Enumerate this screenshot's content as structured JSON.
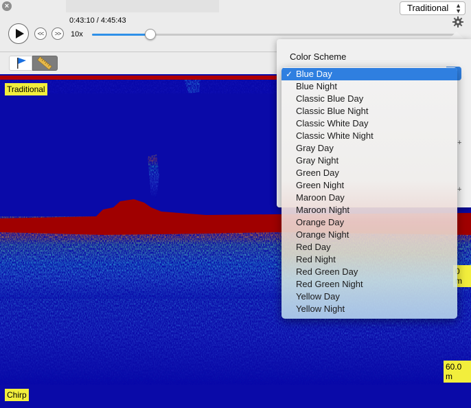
{
  "player": {
    "close_icon": "close-icon",
    "time_readout": "0:43:10 / 4:45:43",
    "speed": "10x",
    "progress_fraction": 0.16,
    "back_label": "<<",
    "forward_label": ">>"
  },
  "view_select": {
    "value": "Traditional"
  },
  "tools": {
    "flag_icon": "flag-icon",
    "ruler_icon": "ruler-icon"
  },
  "sonar": {
    "label_top": "Traditional",
    "label_bottom": "Chirp",
    "depth_mid": "0 m",
    "depth_max": "60.0 m",
    "colors": {
      "background": "#0a0aa8",
      "bottom": "#a00000"
    }
  },
  "settings_panel": {
    "title": "Color Scheme",
    "color_scheme_options": [
      "Blue Day",
      "Blue Night",
      "Classic Blue Day",
      "Classic Blue Night",
      "Classic White Day",
      "Classic White Night",
      "Gray Day",
      "Gray Night",
      "Green Day",
      "Green Night",
      "Maroon Day",
      "Maroon Night",
      "Orange Day",
      "Orange Night",
      "Red Day",
      "Red Night",
      "Red Green Day",
      "Red Green Night",
      "Yellow Day",
      "Yellow Night"
    ],
    "selected_index": 0,
    "check_mark": "✓",
    "plus_sign": "+"
  },
  "accent_color": "#2f7fe0"
}
